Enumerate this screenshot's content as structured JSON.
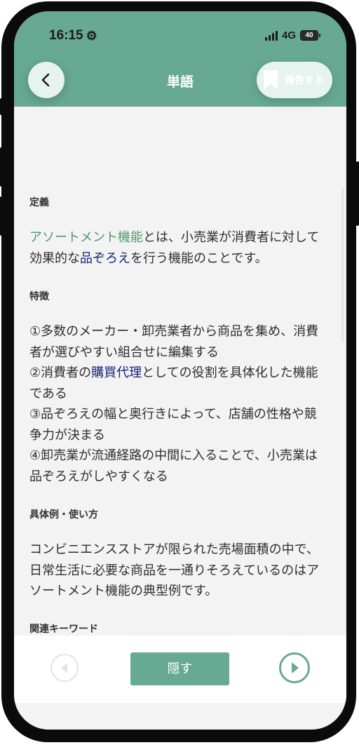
{
  "status_bar": {
    "time": "16:15",
    "network": "4G",
    "battery": "40"
  },
  "header": {
    "title": "単語",
    "report_label": "報告する"
  },
  "sections": {
    "definition": {
      "heading": "定義",
      "term": "アソートメント機能",
      "text_a": "とは、小売業が消費者に対して効果的な",
      "link": "品ぞろえ",
      "text_b": "を行う機能のことです。"
    },
    "features": {
      "heading": "特徴",
      "item1": "①多数のメーカー・卸売業者から商品を集め、消費者が選びやすい組合せに編集する",
      "item2_a": "②消費者の",
      "item2_link": "購買代理",
      "item2_b": "としての役割を具体化した機能である",
      "item3": "③品ぞろえの幅と奥行きによって、店舗の性格や競争力が決まる",
      "item4": "④卸売業が流通経路の中間に入ることで、小売業は品ぞろえがしやすくなる"
    },
    "example": {
      "heading": "具体例・使い方",
      "text": "コンビニエンスストアが限られた売場面積の中で、日常生活に必要な商品を一通りそろえているのはアソートメント機能の典型例です。"
    },
    "related": {
      "heading": "関連キーワード"
    }
  },
  "footer": {
    "hide_label": "隠す"
  },
  "icons": {
    "back": "chevron-left-icon",
    "report": "bookmark-icon",
    "prev": "play-left-icon",
    "next": "play-right-icon",
    "gear": "gear-icon"
  },
  "colors": {
    "accent": "#67a993",
    "term": "#4a9a6e",
    "link": "#14207a",
    "background": "#f3f3f3"
  }
}
